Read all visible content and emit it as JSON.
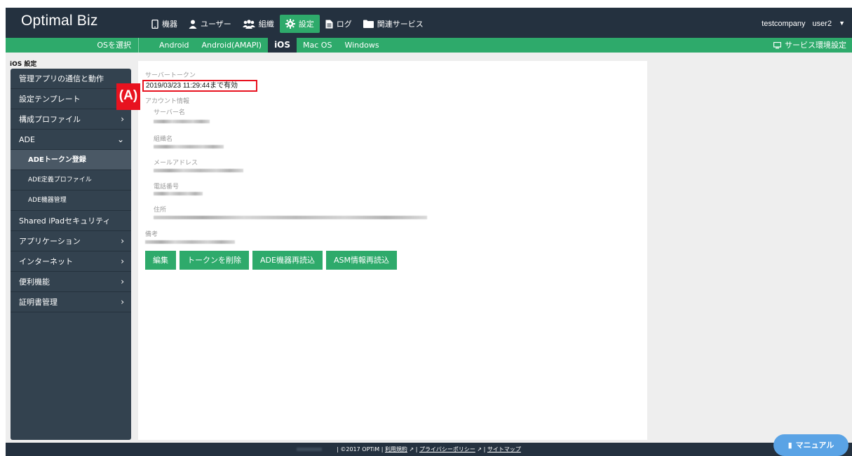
{
  "app": {
    "logo": "Optimal Biz"
  },
  "topnav": {
    "items": [
      {
        "label": "機器",
        "icon": "phone-icon"
      },
      {
        "label": "ユーザー",
        "icon": "user-icon"
      },
      {
        "label": "組織",
        "icon": "group-icon"
      },
      {
        "label": "設定",
        "icon": "gear-icon",
        "active": true
      },
      {
        "label": "ログ",
        "icon": "document-icon"
      },
      {
        "label": "関連サービス",
        "icon": "folder-icon"
      }
    ]
  },
  "user": {
    "company": "testcompany",
    "name": "user2"
  },
  "subbar": {
    "os_select": "OSを選択",
    "tabs": [
      "Android",
      "Android(AMAPI)",
      "iOS",
      "Mac OS",
      "Windows"
    ],
    "active_tab": "iOS",
    "service_env": "サービス環境設定"
  },
  "sidebar": {
    "title": "iOS 設定",
    "items": [
      {
        "label": "管理アプリの通信と動作"
      },
      {
        "label": "設定テンプレート"
      },
      {
        "label": "構成プロファイル",
        "chevron": "›"
      },
      {
        "label": "ADE",
        "chevron": "⌄"
      },
      {
        "label": "ADEトークン登録"
      },
      {
        "label": "ADE定義プロファイル"
      },
      {
        "label": "ADE機器管理"
      },
      {
        "label": "Shared iPadセキュリティ"
      },
      {
        "label": "アプリケーション",
        "chevron": "›"
      },
      {
        "label": "インターネット",
        "chevron": "›"
      },
      {
        "label": "便利機能",
        "chevron": "›"
      },
      {
        "label": "証明書管理",
        "chevron": "›"
      }
    ]
  },
  "content": {
    "server_token_label": "サーバートークン",
    "token_value": "2019/03/23 11:29:44まで有効",
    "annotation": "(A)",
    "account_info_label": "アカウント情報",
    "server_name_label": "サーバー名",
    "org_name_label": "組織名",
    "email_label": "メールアドレス",
    "phone_label": "電話番号",
    "address_label": "住所",
    "notes_label": "備考",
    "buttons": [
      "編集",
      "トークンを削除",
      "ADE機器再読込",
      "ASM情報再読込"
    ]
  },
  "footer": {
    "copyright": "| ©2017 OPTiM |",
    "terms": "利用規約",
    "privacy": "プライバシーポリシー",
    "sitemap": "サイトマップ",
    "sep": "|"
  },
  "manual": {
    "label": "マニュアル"
  },
  "colors": {
    "navy": "#24313f",
    "green": "#2eaa6b",
    "sidebar": "#33424f",
    "red": "#e8121f",
    "manual_blue": "#5aa3e5"
  }
}
